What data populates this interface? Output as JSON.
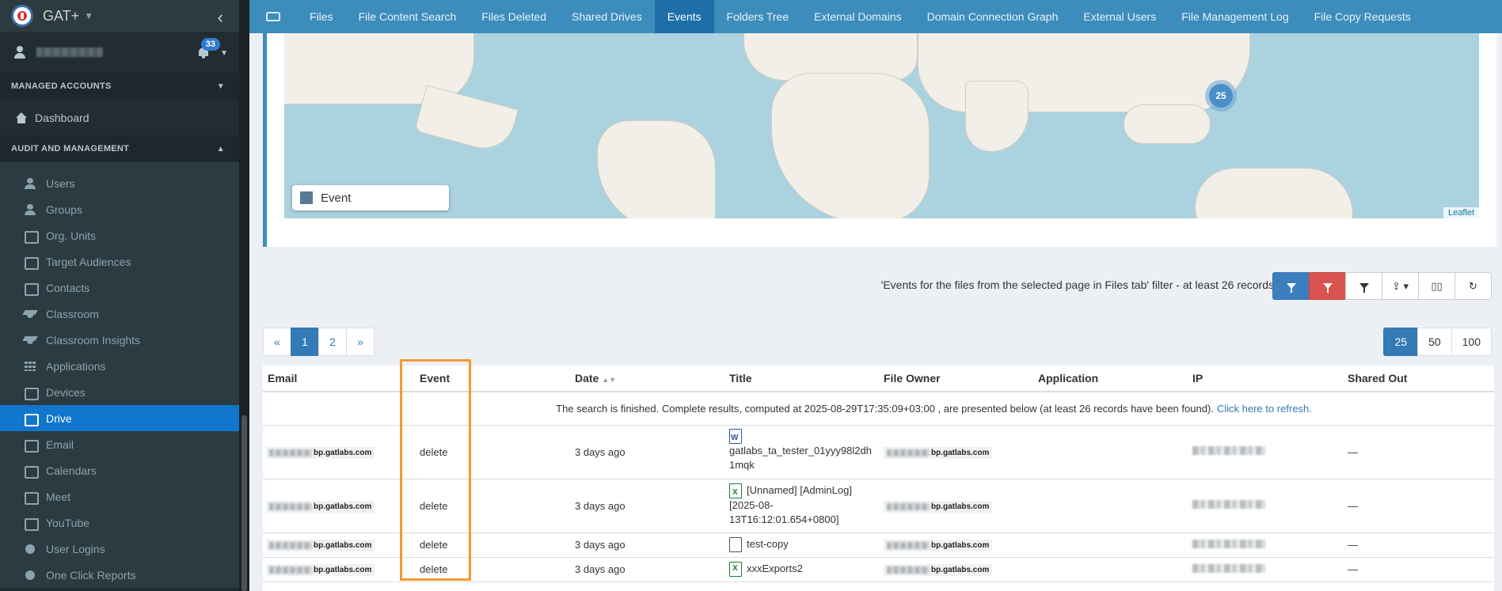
{
  "brand": {
    "name": "GAT+",
    "badge_count": "33"
  },
  "sidebar": {
    "sections": {
      "managed": "MANAGED ACCOUNTS",
      "audit": "AUDIT AND MANAGEMENT"
    },
    "dashboard": "Dashboard",
    "items": [
      {
        "label": "Users",
        "icon": "user-icon"
      },
      {
        "label": "Groups",
        "icon": "groups-icon"
      },
      {
        "label": "Org. Units",
        "icon": "sitemap-icon"
      },
      {
        "label": "Target Audiences",
        "icon": "sitemap-icon"
      },
      {
        "label": "Contacts",
        "icon": "contact-card-icon"
      },
      {
        "label": "Classroom",
        "icon": "graduation-cap-icon"
      },
      {
        "label": "Classroom Insights",
        "icon": "graduation-cap-search-icon"
      },
      {
        "label": "Applications",
        "icon": "grid-icon"
      },
      {
        "label": "Devices",
        "icon": "device-icon"
      },
      {
        "label": "Drive",
        "icon": "drive-icon",
        "active": true
      },
      {
        "label": "Email",
        "icon": "envelope-icon"
      },
      {
        "label": "Calendars",
        "icon": "calendar-icon"
      },
      {
        "label": "Meet",
        "icon": "video-icon"
      },
      {
        "label": "YouTube",
        "icon": "film-icon"
      },
      {
        "label": "User Logins",
        "icon": "globe-icon"
      },
      {
        "label": "One Click Reports",
        "icon": "eye-icon"
      }
    ]
  },
  "topnav": {
    "tabs": [
      "Files",
      "File Content Search",
      "Files Deleted",
      "Shared Drives",
      "Events",
      "Folders Tree",
      "External Domains",
      "Domain Connection Graph",
      "External Users",
      "File Management Log",
      "File Copy Requests"
    ],
    "active": "Events"
  },
  "map": {
    "cluster_count": "25",
    "legend_label": "Event",
    "attribution": "Leaflet"
  },
  "filter": {
    "text": "'Events for the files from the selected page in Files tab' filter -  at least 26 records"
  },
  "pager": {
    "prev": "«",
    "pages": [
      "1",
      "2"
    ],
    "next": "»",
    "current": "1"
  },
  "perpage": {
    "options": [
      "25",
      "50",
      "100"
    ],
    "selected": "25"
  },
  "table": {
    "columns": [
      "Email",
      "Event",
      "Date",
      "Title",
      "File Owner",
      "Application",
      "IP",
      "Shared Out"
    ],
    "notice": "The search is finished. Complete results, computed at 2025-08-29T17:35:09+03:00 , are presented below (at least 26 records have been found).",
    "refresh_link": "Click here to refresh.",
    "email_domain": "bp.gatlabs.com",
    "rows": [
      {
        "event": "delete",
        "date": "3 days ago",
        "title_lines": [
          "gatlabs_ta_tester_01yyy98l2dh",
          "1mqk"
        ],
        "file_icon": "word-file-icon",
        "shared": "—"
      },
      {
        "event": "delete",
        "date": "3 days ago",
        "title_lines": [
          "[Unnamed] [AdminLog]",
          "[2025-08-",
          "13T16:12:01.654+0800]"
        ],
        "file_icon": "excel-file-icon",
        "shared": "—"
      },
      {
        "event": "delete",
        "date": "3 days ago",
        "title_lines": [
          "test-copy"
        ],
        "file_icon": "generic-file-icon",
        "shared": "—"
      },
      {
        "event": "delete",
        "date": "3 days ago",
        "title_lines": [
          "xxxExports2"
        ],
        "file_icon": "excel-file-icon",
        "shared": "—"
      }
    ]
  }
}
